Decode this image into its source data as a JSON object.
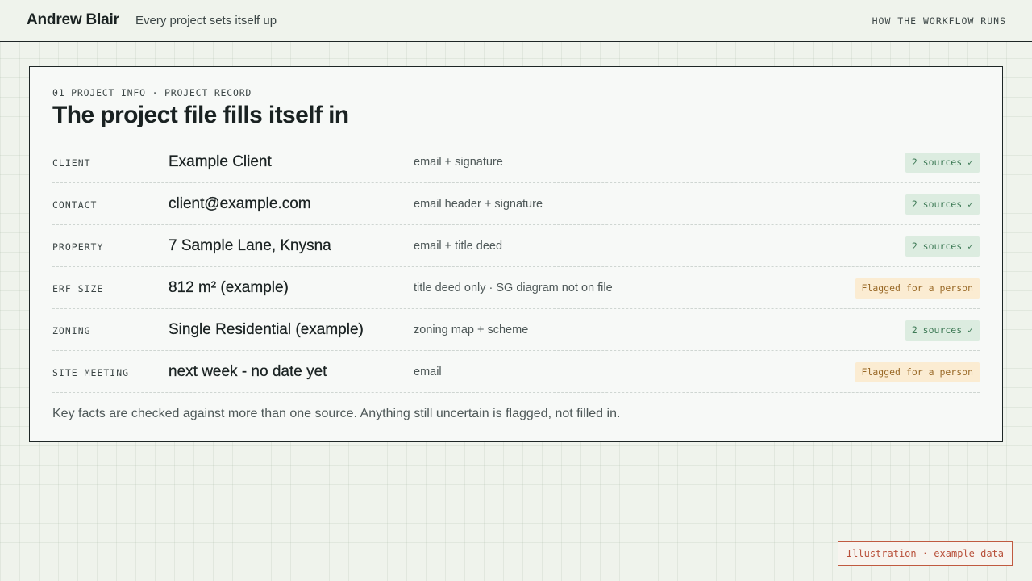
{
  "header": {
    "brand": "Andrew Blair",
    "tagline": "Every project sets itself up",
    "nav_link": "HOW THE WORKFLOW RUNS"
  },
  "card": {
    "eyebrow": "01_PROJECT INFO · PROJECT RECORD",
    "title": "The project file fills itself in",
    "rows": [
      {
        "label": "CLIENT",
        "value": "Example Client",
        "source": "email + signature",
        "status": "2 sources ✓",
        "status_type": "ok"
      },
      {
        "label": "CONTACT",
        "value": "client@example.com",
        "source": "email header + signature",
        "status": "2 sources ✓",
        "status_type": "ok"
      },
      {
        "label": "PROPERTY",
        "value": "7 Sample Lane, Knysna",
        "source": "email + title deed",
        "status": "2 sources ✓",
        "status_type": "ok"
      },
      {
        "label": "ERF SIZE",
        "value": "812 m² (example)",
        "source": "title deed only · SG diagram not on file",
        "status": "Flagged for a person",
        "status_type": "flag"
      },
      {
        "label": "ZONING",
        "value": "Single Residential (example)",
        "source": "zoning map + scheme",
        "status": "2 sources ✓",
        "status_type": "ok"
      },
      {
        "label": "SITE MEETING",
        "value": "next week - no date yet",
        "source": "email",
        "status": "Flagged for a person",
        "status_type": "flag"
      }
    ],
    "footnote": "Key facts are checked against more than one source. Anything still uncertain is flagged, not filled in."
  },
  "stamp": "Illustration · example data",
  "colors": {
    "background": "#eff3ec",
    "ok_badge_bg": "#dcece0",
    "ok_badge_text": "#3e7a56",
    "flag_badge_bg": "#fbecd2",
    "flag_badge_text": "#9a6a28",
    "stamp_border": "#c05a40"
  }
}
